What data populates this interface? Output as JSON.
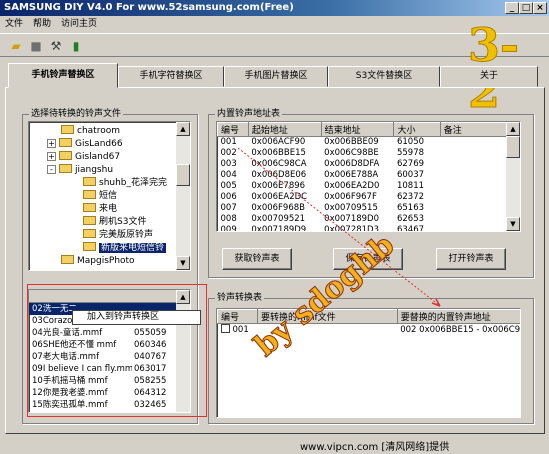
{
  "window": {
    "title": "SAMSUNG DIY V4.0 For www.52samsung.com(Free)",
    "min": "_",
    "max": "□",
    "close": "×"
  },
  "menu": [
    "文件",
    "帮助",
    "访问主页"
  ],
  "overlay_big": "3-2",
  "tabs": [
    "手机铃声替换区",
    "手机字符替换区",
    "手机图片替换区",
    "S3文件替换区",
    "关于"
  ],
  "select_group": {
    "label": "选择待转换的铃声文件",
    "tree": [
      {
        "label": "chatroom",
        "indent": 1,
        "exp": ""
      },
      {
        "label": "GisLand66",
        "indent": 1,
        "exp": "+"
      },
      {
        "label": "Gisland67",
        "indent": 1,
        "exp": "+"
      },
      {
        "label": "jiangshu",
        "indent": 1,
        "exp": "-"
      },
      {
        "label": "shuhb_花泽完完",
        "indent": 2,
        "exp": ""
      },
      {
        "label": "短信",
        "indent": 2,
        "exp": ""
      },
      {
        "label": "来电",
        "indent": 2,
        "exp": ""
      },
      {
        "label": "刷机S3文件",
        "indent": 2,
        "exp": ""
      },
      {
        "label": "完美版原铃声",
        "indent": 2,
        "exp": ""
      },
      {
        "label": "新版来电短信铃",
        "indent": 2,
        "exp": "",
        "selected": true
      },
      {
        "label": "MapgisPhoto",
        "indent": 1,
        "exp": ""
      }
    ],
    "files": [
      "02洗一无二",
      "03Corazon D",
      "04光良-童话.mmf",
      "06SHE他还不懂 mmf",
      "07老大电话.mmf",
      "09I believe I can fly.mmf",
      "10手机摇马桶 mmf",
      "12你是我老婆.mmf",
      "15陈奕迅孤单.mmf"
    ],
    "file_sizes": [
      "",
      "",
      "055059",
      "060346",
      "040767",
      "063017",
      "058255",
      "064312",
      "032465"
    ],
    "context_menu": "加入到铃声转换区"
  },
  "builtin": {
    "label": "内置铃声地址表",
    "columns": [
      "编号",
      "起始地址",
      "结束地址",
      "大小",
      "备注"
    ],
    "rows": [
      [
        "001",
        "0x006ACF90",
        "0x006BBE09",
        "61050",
        ""
      ],
      [
        "002",
        "0x006BBE15",
        "0x006C98BE",
        "55978",
        ""
      ],
      [
        "003",
        "0x006C98CA",
        "0x006D8DFA",
        "62769",
        ""
      ],
      [
        "004",
        "0x006D8E06",
        "0x006E788A",
        "60037",
        ""
      ],
      [
        "005",
        "0x006E7896",
        "0x006EA2D0",
        "10811",
        ""
      ],
      [
        "006",
        "0x006EA2DC",
        "0x006F967F",
        "62372",
        ""
      ],
      [
        "007",
        "0x006F968B",
        "0x00709515",
        "65163",
        ""
      ],
      [
        "008",
        "0x00709521",
        "0x007189D0",
        "62653",
        ""
      ],
      [
        "009",
        "0x007189D9",
        "0x007281D3",
        "63467",
        ""
      ]
    ]
  },
  "buttons": {
    "get": "获取铃声表",
    "save": "保存铃声表",
    "open": "打开铃声表"
  },
  "convert": {
    "label": "铃声转换表",
    "columns": [
      "编号",
      "要转换的mmf文件",
      "要替换的内置铃声地址"
    ],
    "rows": [
      [
        "001",
        "",
        "002 0x006BBE15 - 0x006C9"
      ]
    ]
  },
  "watermark": "by sdoghb",
  "footer": "www.vipcn.com [清风网络]提供"
}
